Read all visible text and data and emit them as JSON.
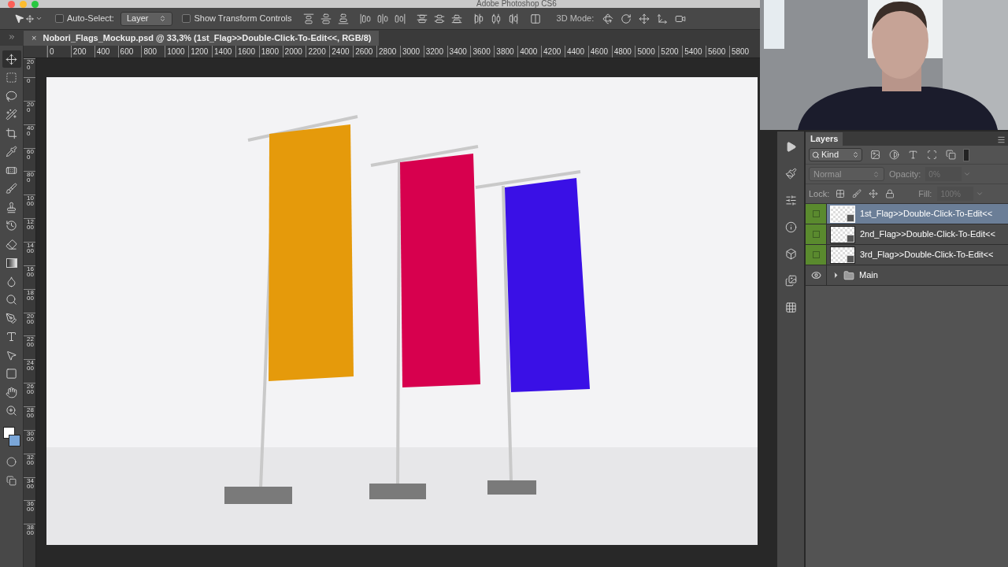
{
  "title_bar": {
    "title": "Adobe Photoshop CS6"
  },
  "options_bar": {
    "auto_select": {
      "label": "Auto-Select:",
      "checked": false
    },
    "auto_select_target": "Layer",
    "transform_controls": {
      "label": "Show Transform Controls",
      "checked": false
    },
    "mode_label": "3D Mode:"
  },
  "document_tab": {
    "title": "Nobori_Flags_Mockup.psd @ 33,3% (1st_Flag>>Double-Click-To-Edit<<, RGB/8)",
    "close": "×"
  },
  "rulers": {
    "horizontal": [
      "0",
      "200",
      "400",
      "600",
      "800",
      "1000",
      "1200",
      "1400",
      "1600",
      "1800",
      "2000",
      "2200",
      "2400",
      "2600",
      "2800",
      "3000",
      "3200",
      "3400",
      "3600",
      "3800",
      "4000",
      "4200",
      "4400",
      "4600",
      "4800",
      "5000",
      "5200",
      "5400",
      "5600",
      "5800"
    ],
    "vertical": [
      "200",
      "0",
      "200",
      "400",
      "600",
      "800",
      "1000",
      "1200",
      "1400",
      "1600",
      "1800",
      "2000",
      "2200",
      "2400",
      "2600",
      "2800",
      "3000",
      "3200",
      "3400",
      "3600",
      "3800"
    ]
  },
  "layers_panel": {
    "title": "Layers",
    "filter": "Kind",
    "blend_mode": "Normal",
    "opacity": {
      "label": "Opacity:",
      "value": "0%",
      "disabled": true
    },
    "lock_label": "Lock:",
    "fill": {
      "label": "Fill:",
      "value": "100%",
      "disabled": true
    },
    "layers": [
      {
        "name": "1st_Flag>>Double-Click-To-Edit<<",
        "kind": "smart_object",
        "visible": false,
        "selected": true,
        "color": "#5a8a2e"
      },
      {
        "name": "2nd_Flag>>Double-Click-To-Edit<<",
        "kind": "smart_object",
        "visible": false,
        "selected": false,
        "color": "#5a8a2e"
      },
      {
        "name": "3rd_Flag>>Double-Click-To-Edit<<",
        "kind": "smart_object",
        "visible": false,
        "selected": false,
        "color": "#5a8a2e"
      },
      {
        "name": "Main",
        "kind": "group",
        "visible": true,
        "selected": false
      }
    ]
  }
}
